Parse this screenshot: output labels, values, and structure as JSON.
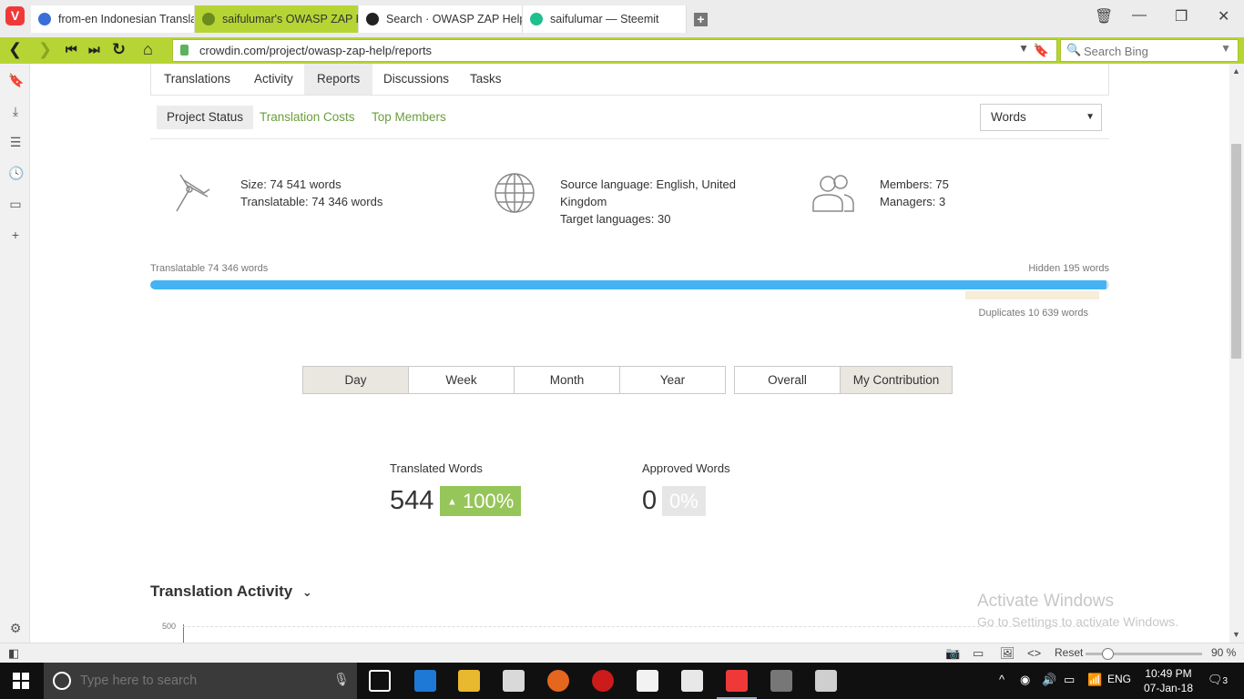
{
  "browser": {
    "tabs": [
      {
        "title": "from-en Indonesian Translat",
        "icon_color": "#3a6fd8"
      },
      {
        "title": "saifulumar's OWASP ZAP He",
        "icon_color": "#6a8c1e",
        "active": true
      },
      {
        "title": "Search · OWASP ZAP Help · C",
        "icon_color": "#222222"
      },
      {
        "title": "saifulumar — Steemit",
        "icon_color": "#1fbf8f"
      }
    ],
    "vivaldi_letter": "V",
    "url": "crowdin.com/project/owasp-zap-help/reports",
    "search_placeholder": "Search Bing"
  },
  "project_nav": {
    "items": [
      "Translations",
      "Activity",
      "Reports",
      "Discussions",
      "Tasks"
    ],
    "active": "Reports"
  },
  "reports_nav": {
    "items": [
      "Project Status",
      "Translation Costs",
      "Top Members"
    ],
    "active": "Project Status",
    "unit_select": "Words"
  },
  "stats": {
    "size": "Size: 74 541 words",
    "translatable": "Translatable: 74 346 words",
    "source_language": "Source language: English, United",
    "source_language_cont": "Kingdom",
    "target_languages": "Target languages: 30",
    "members": "Members: 75",
    "managers": "Managers: 3"
  },
  "progress": {
    "left_label": "Translatable 74 346 words",
    "right_label": "Hidden 195 words",
    "duplicates_label": "Duplicates 10 639 words",
    "translatable_fraction": 0.9974
  },
  "period_buttons": [
    "Day",
    "Week",
    "Month",
    "Year"
  ],
  "period_active": "Day",
  "scope_buttons": [
    "Overall",
    "My Contribution"
  ],
  "scope_active": "My Contribution",
  "metrics": {
    "translated_label": "Translated Words",
    "translated_value": "544",
    "translated_change": "100%",
    "translated_arrow": "▲",
    "approved_label": "Approved Words",
    "approved_value": "0",
    "approved_change": "0%"
  },
  "activity": {
    "title": "Translation Activity",
    "y_tick": "500"
  },
  "watermark": {
    "line1": "Activate Windows",
    "line2": "Go to Settings to activate Windows."
  },
  "statusbar": {
    "reset": "Reset",
    "zoom": "90 %"
  },
  "taskbar": {
    "search_placeholder": "Type here to search",
    "language": "ENG",
    "time": "10:49 PM",
    "date": "07-Jan-18",
    "notifications": "3"
  }
}
